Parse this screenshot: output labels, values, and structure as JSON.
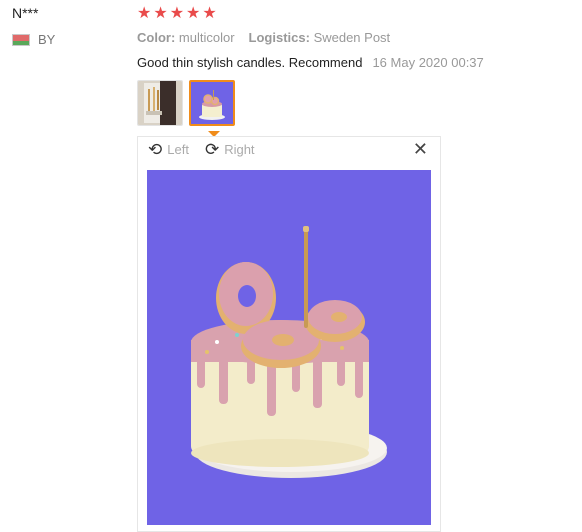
{
  "review": {
    "user_name": "N***",
    "country_code": "BY",
    "rating": 5,
    "color_label": "Color:",
    "color_value": "multicolor",
    "logistics_label": "Logistics:",
    "logistics_value": "Sweden Post",
    "text": "Good thin stylish candles. Recommend",
    "date": "16 May 2020 00:37"
  },
  "viewer": {
    "rotate_left_label": "Left",
    "rotate_right_label": "Right",
    "close_icon": "close-icon",
    "rotate_left_icon": "rotate-left-icon",
    "rotate_right_icon": "rotate-right-icon"
  },
  "colors": {
    "star": "#e94b4b",
    "accent": "#f08c1a",
    "photo_background": "#6f63e6"
  }
}
